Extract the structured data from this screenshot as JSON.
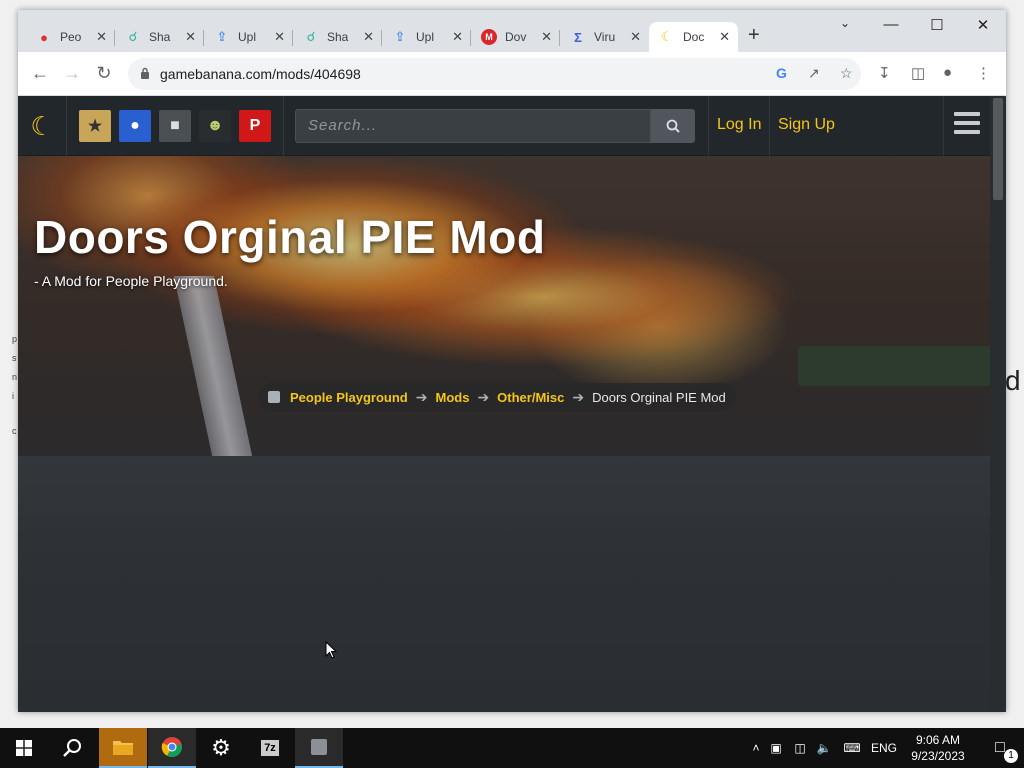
{
  "browser": {
    "tabs": [
      {
        "label": "Peo",
        "icon": "gamepad-icon",
        "color": "#e03030"
      },
      {
        "label": "Sha",
        "icon": "share-icon",
        "color": "#2fb3a0"
      },
      {
        "label": "Upl",
        "icon": "upload-icon",
        "color": "#1a73e8"
      },
      {
        "label": "Sha",
        "icon": "share-icon",
        "color": "#2fb3a0"
      },
      {
        "label": "Upl",
        "icon": "upload-icon",
        "color": "#1a73e8"
      },
      {
        "label": "Dov",
        "icon": "mega-icon",
        "color": "#d9272e"
      },
      {
        "label": "Viru",
        "icon": "virustotal-icon",
        "color": "#3b61d6"
      },
      {
        "label": "Doc",
        "icon": "banana-icon",
        "color": "#f5c518"
      }
    ],
    "new_tab": "+",
    "url": "gamebanana.com/mods/404698"
  },
  "site": {
    "search_placeholder": "Search...",
    "login": "Log In",
    "signup": "Sign Up"
  },
  "hero": {
    "title": "Doors Orginal PIE Mod",
    "subtitle": "- A Mod for People Playground.",
    "breadcrumb": [
      "People Playground",
      "Mods",
      "Other/Misc",
      "Doors Orginal PIE Mod"
    ]
  },
  "desktop_edge": {
    "right_text": "d",
    "left_chars": [
      "p",
      "s",
      "n",
      "i",
      "c"
    ]
  },
  "taskbar": {
    "lang": "ENG",
    "time": "9:06 AM",
    "date": "9/23/2023",
    "notif_count": "1"
  }
}
